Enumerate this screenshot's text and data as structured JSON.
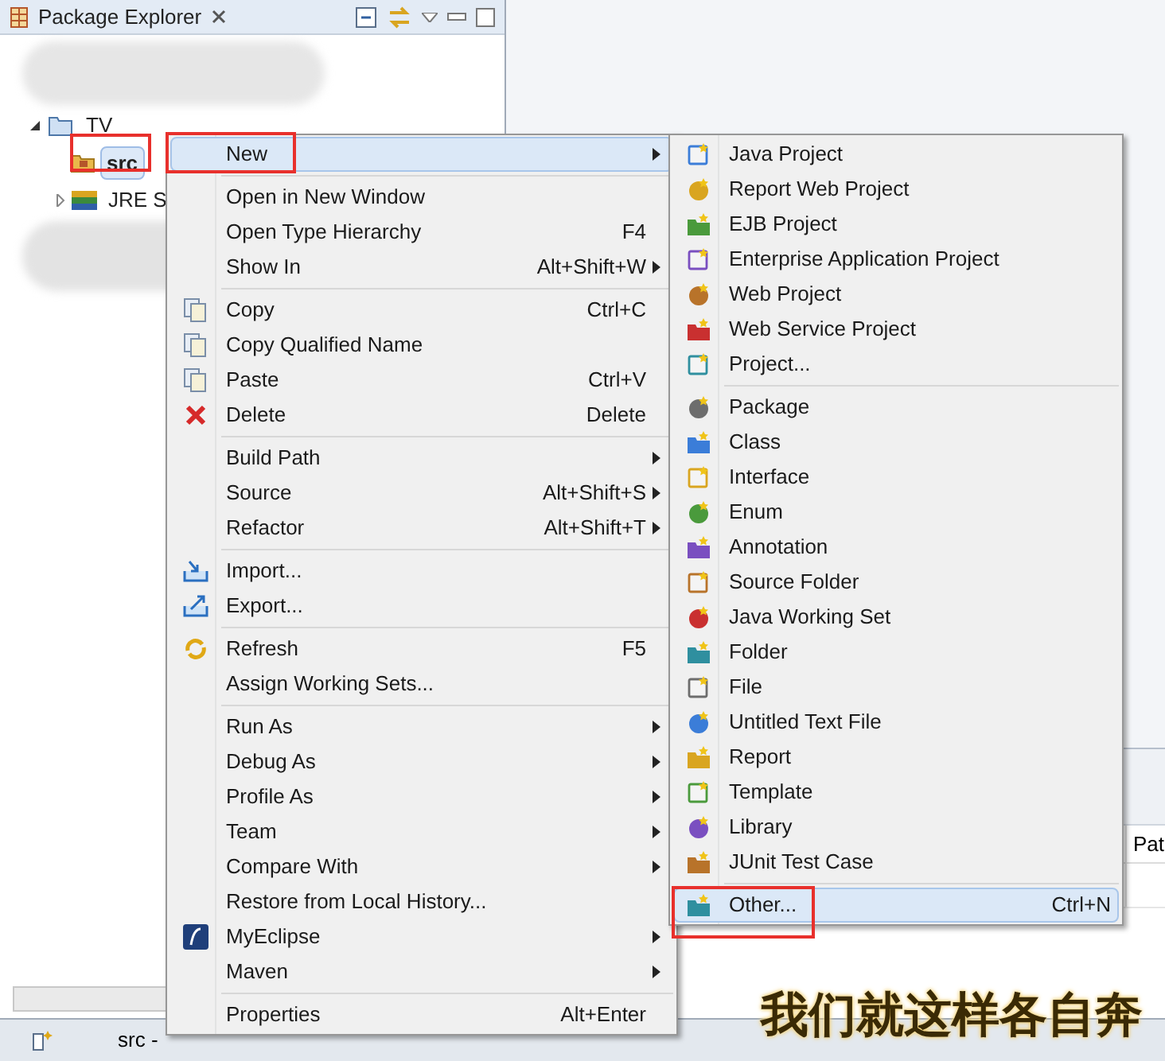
{
  "view": {
    "title": "Package Explorer"
  },
  "tree": [
    {
      "label": "TV",
      "expanded": true,
      "selected": false,
      "children": [
        {
          "label": "src",
          "selected": true
        },
        {
          "label": "JRE S",
          "selected": false,
          "expanded": false
        }
      ]
    }
  ],
  "context_menu": {
    "groups": [
      [
        {
          "label": "New",
          "submenu": true,
          "selected": true
        }
      ],
      [
        {
          "label": "Open in New Window",
          "submenu": false,
          "selected": false
        },
        {
          "label": "Open Type Hierarchy",
          "shortcut": "F4",
          "submenu": false,
          "selected": false
        },
        {
          "label": "Show In",
          "shortcut": "Alt+Shift+W",
          "submenu": true,
          "selected": false
        }
      ],
      [
        {
          "label": "Copy",
          "shortcut": "Ctrl+C",
          "submenu": false,
          "selected": false
        },
        {
          "label": "Copy Qualified Name",
          "submenu": false,
          "selected": false
        },
        {
          "label": "Paste",
          "shortcut": "Ctrl+V",
          "submenu": false,
          "selected": false
        },
        {
          "label": "Delete",
          "shortcut": "Delete",
          "submenu": false,
          "selected": false
        }
      ],
      [
        {
          "label": "Build Path",
          "submenu": true,
          "selected": false
        },
        {
          "label": "Source",
          "shortcut": "Alt+Shift+S",
          "submenu": true,
          "selected": false
        },
        {
          "label": "Refactor",
          "shortcut": "Alt+Shift+T",
          "submenu": true,
          "selected": false
        }
      ],
      [
        {
          "label": "Import...",
          "submenu": false,
          "selected": false
        },
        {
          "label": "Export...",
          "submenu": false,
          "selected": false
        }
      ],
      [
        {
          "label": "Refresh",
          "shortcut": "F5",
          "submenu": false,
          "selected": false
        },
        {
          "label": "Assign Working Sets...",
          "submenu": false,
          "selected": false
        }
      ],
      [
        {
          "label": "Run As",
          "submenu": true,
          "selected": false
        },
        {
          "label": "Debug As",
          "submenu": true,
          "selected": false
        },
        {
          "label": "Profile As",
          "submenu": true,
          "selected": false
        },
        {
          "label": "Team",
          "submenu": true,
          "selected": false
        },
        {
          "label": "Compare With",
          "submenu": true,
          "selected": false
        },
        {
          "label": "Restore from Local History...",
          "submenu": false,
          "selected": false
        },
        {
          "label": "MyEclipse",
          "submenu": true,
          "selected": false
        },
        {
          "label": "Maven",
          "submenu": true,
          "selected": false
        }
      ],
      [
        {
          "label": "Properties",
          "shortcut": "Alt+Enter",
          "submenu": false,
          "selected": false
        }
      ]
    ]
  },
  "new_submenu": {
    "groups": [
      [
        {
          "label": "Java Project",
          "selected": false
        },
        {
          "label": "Report Web Project",
          "selected": false
        },
        {
          "label": "EJB Project",
          "selected": false
        },
        {
          "label": "Enterprise Application Project",
          "selected": false
        },
        {
          "label": "Web Project",
          "selected": false
        },
        {
          "label": "Web Service Project",
          "selected": false
        },
        {
          "label": "Project...",
          "selected": false
        }
      ],
      [
        {
          "label": "Package",
          "selected": false
        },
        {
          "label": "Class",
          "selected": false
        },
        {
          "label": "Interface",
          "selected": false
        },
        {
          "label": "Enum",
          "selected": false
        },
        {
          "label": "Annotation",
          "selected": false
        },
        {
          "label": "Source Folder",
          "selected": false
        },
        {
          "label": "Java Working Set",
          "selected": false
        },
        {
          "label": "Folder",
          "selected": false
        },
        {
          "label": "File",
          "selected": false
        },
        {
          "label": "Untitled Text File",
          "selected": false
        },
        {
          "label": "Report",
          "selected": false
        },
        {
          "label": "Template",
          "selected": false
        },
        {
          "label": "Library",
          "selected": false
        },
        {
          "label": "JUnit Test Case",
          "selected": false
        }
      ],
      [
        {
          "label": "Other...",
          "shortcut": "Ctrl+N",
          "selected": true
        }
      ]
    ]
  },
  "table": {
    "columns": [
      "Pat"
    ]
  },
  "status_bar": {
    "text": "src -"
  },
  "caption": "我们就这样各自奔"
}
